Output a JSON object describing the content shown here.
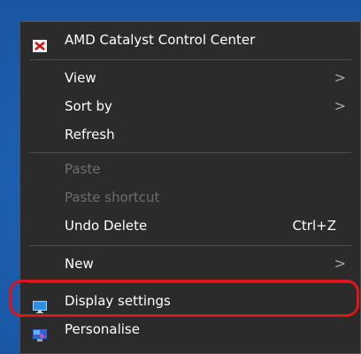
{
  "menu": {
    "items": [
      {
        "label": "AMD Catalyst Control Center",
        "icon": "amd-catalyst-icon",
        "enabled": true
      },
      {
        "label": "View",
        "submenu": true,
        "enabled": true
      },
      {
        "label": "Sort by",
        "submenu": true,
        "enabled": true
      },
      {
        "label": "Refresh",
        "enabled": true
      },
      {
        "label": "Paste",
        "enabled": false
      },
      {
        "label": "Paste shortcut",
        "enabled": false
      },
      {
        "label": "Undo Delete",
        "shortcut": "Ctrl+Z",
        "enabled": true
      },
      {
        "label": "New",
        "submenu": true,
        "enabled": true
      },
      {
        "label": "Display settings",
        "icon": "display-settings-icon",
        "enabled": true
      },
      {
        "label": "Personalise",
        "icon": "personalise-icon",
        "enabled": true
      }
    ],
    "chevron_glyph": ">"
  },
  "colors": {
    "desktop": "#1a56a3",
    "menu_bg": "#2b2b2b",
    "text": "#ffffff",
    "disabled_text": "#6d6d6d",
    "highlight": "#e0141b"
  }
}
